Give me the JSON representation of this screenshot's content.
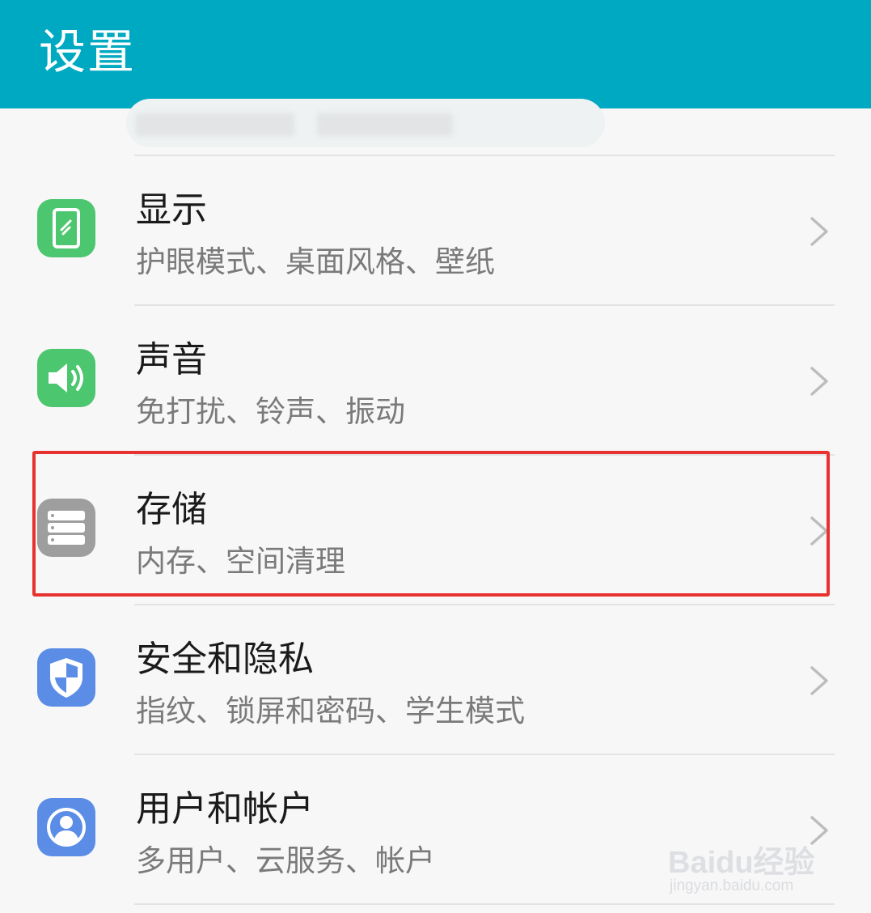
{
  "header": {
    "title": "设置",
    "background": "#00a9c2"
  },
  "settings_items": [
    {
      "title": "显示",
      "subtitle": "护眼模式、桌面风格、壁纸",
      "icon": "display-icon",
      "icon_color": "#4cc66f"
    },
    {
      "title": "声音",
      "subtitle": "免打扰、铃声、振动",
      "icon": "speaker-icon",
      "icon_color": "#4cc66f"
    },
    {
      "title": "存储",
      "subtitle": "内存、空间清理",
      "icon": "storage-icon",
      "icon_color": "#9e9e9e",
      "highlighted": true
    },
    {
      "title": "安全和隐私",
      "subtitle": "指纹、锁屏和密码、学生模式",
      "icon": "shield-icon",
      "icon_color": "#5b8de6"
    },
    {
      "title": "用户和帐户",
      "subtitle": "多用户、云服务、帐户",
      "icon": "user-account-icon",
      "icon_color": "#5b8de6"
    }
  ],
  "highlight_color": "#e8322f",
  "watermark": {
    "logo": "Baidu经验",
    "url": "jingyan.baidu.com"
  }
}
